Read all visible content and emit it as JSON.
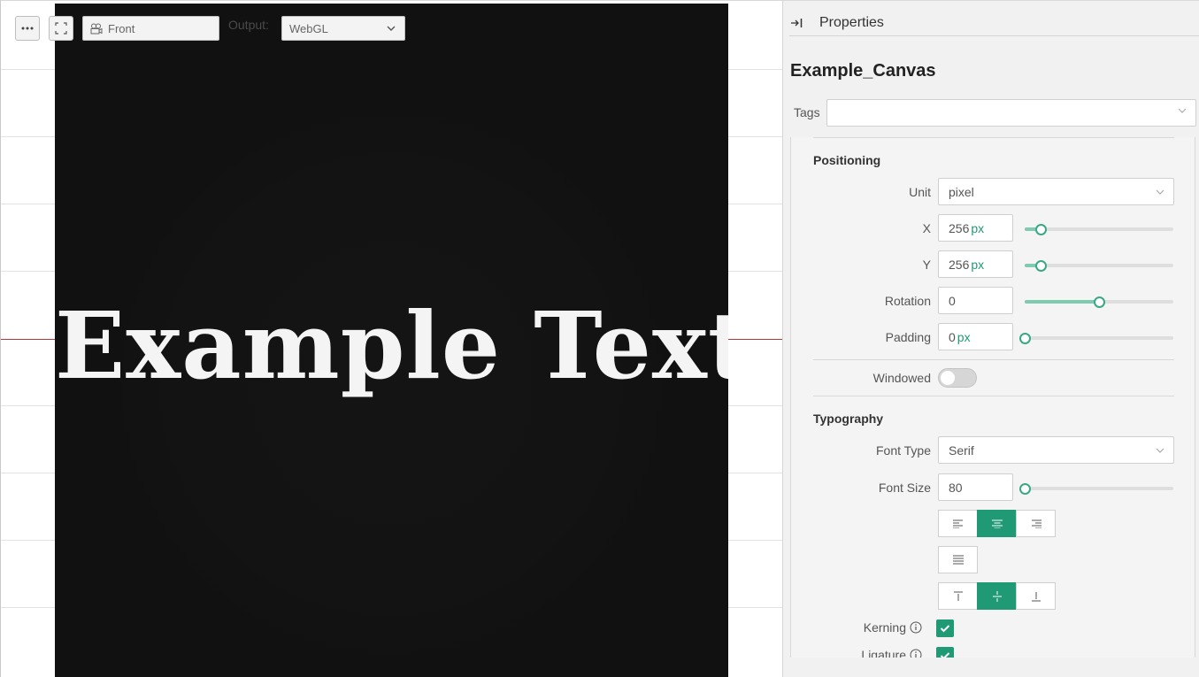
{
  "toolbar": {
    "more_icon": "more-horizontal-icon",
    "fullscreen_icon": "fullscreen-icon",
    "camera_icon": "camera-icon",
    "camera_value": "Front",
    "output_label": "Output:",
    "output_value": "WebGL"
  },
  "canvas": {
    "text": "Example Text",
    "background": "#111111",
    "text_color": "#f4f4f4"
  },
  "panel": {
    "title": "Properties",
    "object_name": "Example_Canvas",
    "tags_label": "Tags",
    "tags_value": "",
    "accent_color": "#1f9a74",
    "positioning": {
      "title": "Positioning",
      "unit_label": "Unit",
      "unit_value": "pixel",
      "x_label": "X",
      "x_value": "256",
      "x_unit": "px",
      "x_slider": 0.11,
      "y_label": "Y",
      "y_value": "256",
      "y_unit": "px",
      "y_slider": 0.11,
      "rotation_label": "Rotation",
      "rotation_value": "0",
      "rotation_slider": 0.5,
      "padding_label": "Padding",
      "padding_value": "0",
      "padding_unit": "px",
      "padding_slider": 0.0
    },
    "windowed": {
      "label": "Windowed",
      "on": false
    },
    "typography": {
      "title": "Typography",
      "font_type_label": "Font Type",
      "font_type_value": "Serif",
      "font_size_label": "Font Size",
      "font_size_value": "80",
      "font_size_slider": 0.0,
      "align": [
        "align-left",
        "align-center",
        "align-right"
      ],
      "align_selected": "align-center",
      "justify_icon": "align-justify-icon",
      "vertical_align": [
        "align-top",
        "align-middle",
        "align-bottom"
      ],
      "vertical_align_selected": "align-middle",
      "kerning_label": "Kerning",
      "kerning_checked": true,
      "ligature_label": "Ligature",
      "ligature_checked": true
    }
  }
}
